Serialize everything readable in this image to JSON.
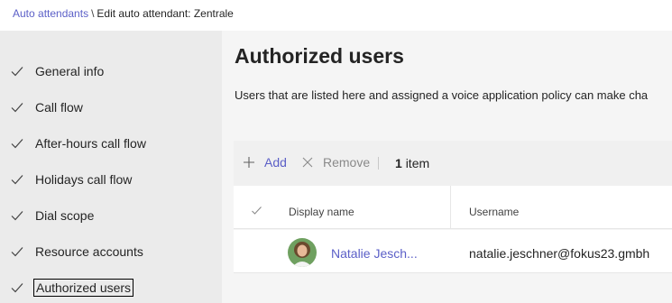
{
  "breadcrumb": {
    "parent": "Auto attendants",
    "separator": "\\",
    "current": "Edit auto attendant: Zentrale"
  },
  "sidebar": {
    "items": [
      {
        "label": "General info",
        "icon": "checkmark-icon"
      },
      {
        "label": "Call flow",
        "icon": "checkmark-icon"
      },
      {
        "label": "After-hours call flow",
        "icon": "checkmark-icon"
      },
      {
        "label": "Holidays call flow",
        "icon": "checkmark-icon"
      },
      {
        "label": "Dial scope",
        "icon": "checkmark-icon"
      },
      {
        "label": "Resource accounts",
        "icon": "checkmark-icon"
      },
      {
        "label": "Authorized users",
        "icon": "checkmark-icon",
        "active": true
      }
    ]
  },
  "main": {
    "title": "Authorized users",
    "description": "Users that are listed here and assigned a voice application policy can make cha"
  },
  "toolbar": {
    "add_label": "Add",
    "add_icon": "plus-icon",
    "remove_label": "Remove",
    "remove_icon": "close-icon",
    "count_value": "1",
    "count_unit": "item"
  },
  "table": {
    "columns": [
      "Display name",
      "Username"
    ],
    "rows": [
      {
        "display_name": "Natalie Jesch...",
        "username": "natalie.jeschner@fokus23.gmbh"
      }
    ]
  },
  "colors": {
    "accent": "#5b5fc7",
    "sidebar_bg": "#ebebeb",
    "main_bg": "#f5f5f5"
  }
}
